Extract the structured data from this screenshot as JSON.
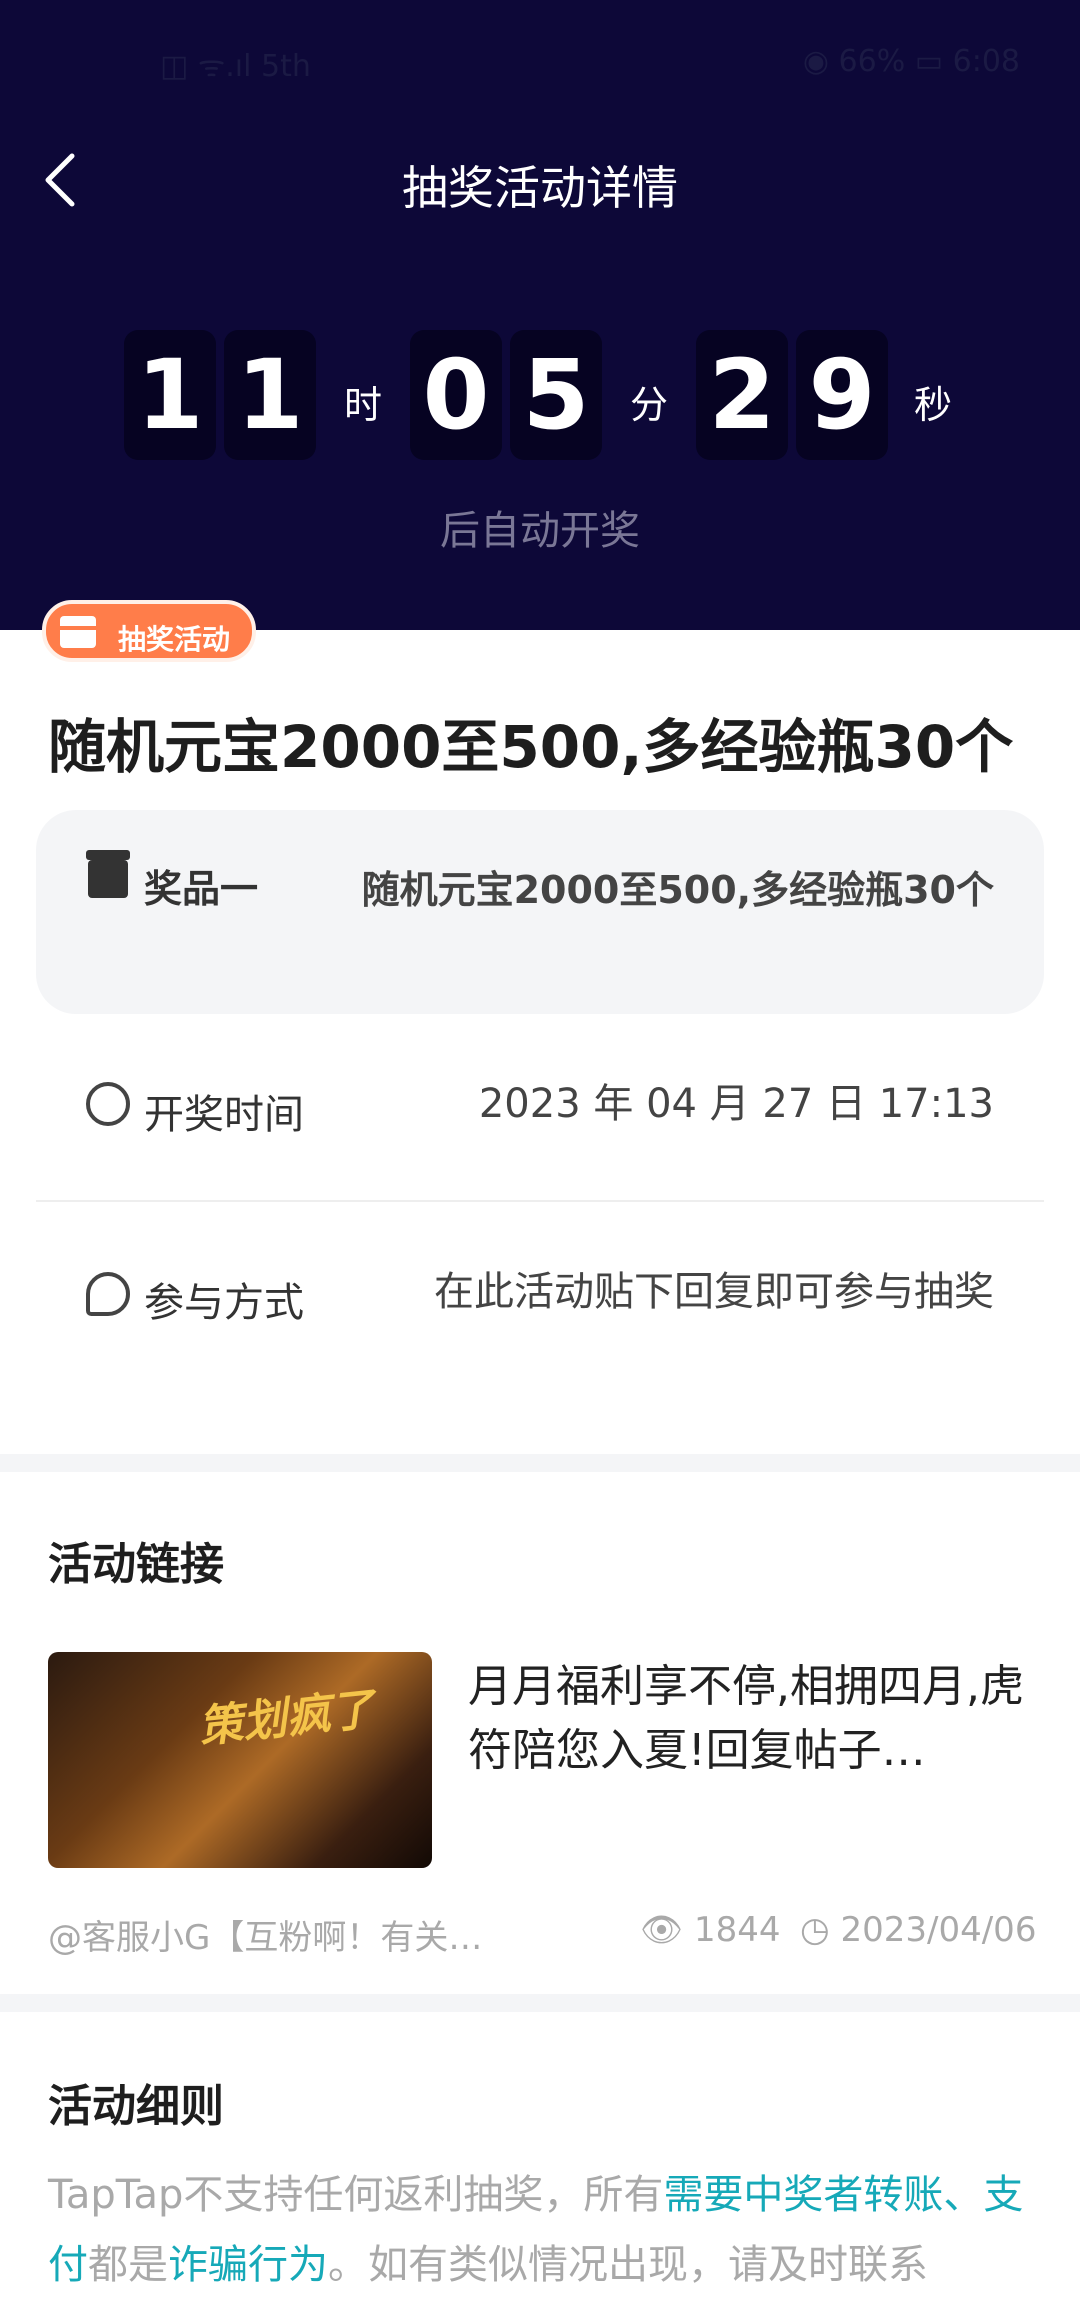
{
  "status_bar": {
    "left": "◫ ᯤ.ıl 5th",
    "right": "◉ 66% ▭ 6:08"
  },
  "header": {
    "back_label": "‹",
    "title": "抽奖活动详情"
  },
  "countdown": {
    "hours": [
      "1",
      "1"
    ],
    "minutes": [
      "0",
      "5"
    ],
    "seconds": [
      "2",
      "9"
    ],
    "hour_unit": "时",
    "minute_unit": "分",
    "second_unit": "秒",
    "subtitle": "后自动开奖"
  },
  "badge": {
    "label": "抽奖活动"
  },
  "main_title": "随机元宝2000至500,多经验瓶30个",
  "prize": {
    "label": "奖品一",
    "value": "随机元宝2000至500,多经验瓶30个"
  },
  "draw_time": {
    "label": "开奖时间",
    "value": "2023 年 04 月 27 日 17:13"
  },
  "participation": {
    "label": "参与方式",
    "value": "在此活动贴下回复即可参与抽奖"
  },
  "link_section": {
    "title": "活动链接",
    "thumbnail_text": "策划疯了",
    "post_title": "月月福利享不停,相拥四月,虎符陪您入夏!回复帖子…",
    "author": "@客服小G【互粉啊！有关…",
    "views": "1844",
    "date": "2023/04/06"
  },
  "rules_section": {
    "title": "活动细则",
    "text_1": "TapTap不支持任何返利抽奖，所有",
    "highlight_1": "需要中奖者转账、支付",
    "text_2": "都是",
    "highlight_2": "诈骗行为",
    "text_3": "。如有类似情况出现，请及时联系"
  },
  "colors": {
    "header_bg": "#0d0838",
    "badge": "#ff7d4a",
    "link_highlight": "#16a9b8"
  }
}
